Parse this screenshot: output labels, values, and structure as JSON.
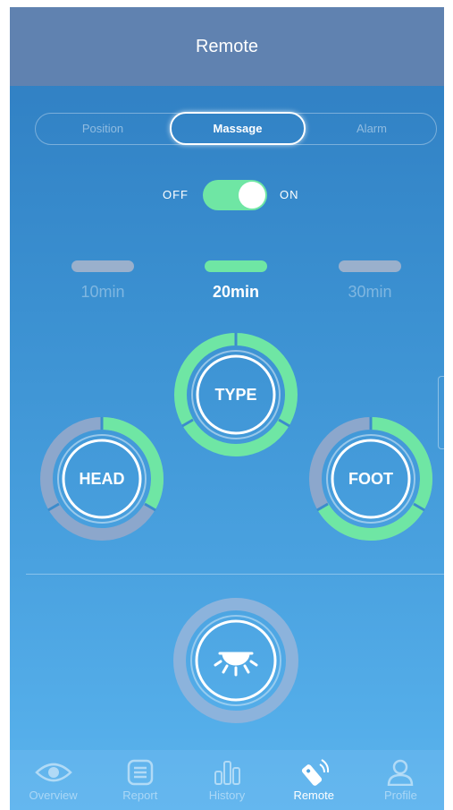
{
  "header": {
    "title": "Remote"
  },
  "mode_tabs": [
    {
      "label": "Position",
      "active": false
    },
    {
      "label": "Massage",
      "active": true
    },
    {
      "label": "Alarm",
      "active": false
    }
  ],
  "power": {
    "off_label": "OFF",
    "on_label": "ON",
    "state": "on"
  },
  "timers": [
    {
      "label": "10min",
      "active": false
    },
    {
      "label": "20min",
      "active": true
    },
    {
      "label": "30min",
      "active": false
    }
  ],
  "zones": {
    "type": {
      "label": "TYPE"
    },
    "head": {
      "label": "HEAD"
    },
    "foot": {
      "label": "FOOT"
    }
  },
  "light": {
    "icon": "ceiling-light-icon"
  },
  "bottom_nav": [
    {
      "label": "Overview",
      "icon": "eye-icon",
      "active": false
    },
    {
      "label": "Report",
      "icon": "list-icon",
      "active": false
    },
    {
      "label": "History",
      "icon": "bar-chart-icon",
      "active": false
    },
    {
      "label": "Remote",
      "icon": "remote-icon",
      "active": true
    },
    {
      "label": "Profile",
      "icon": "person-icon",
      "active": false
    }
  ],
  "colors": {
    "accent": "#6fe6a4",
    "header": "#6082b0",
    "inactive_ring": "#8ca7cc"
  }
}
